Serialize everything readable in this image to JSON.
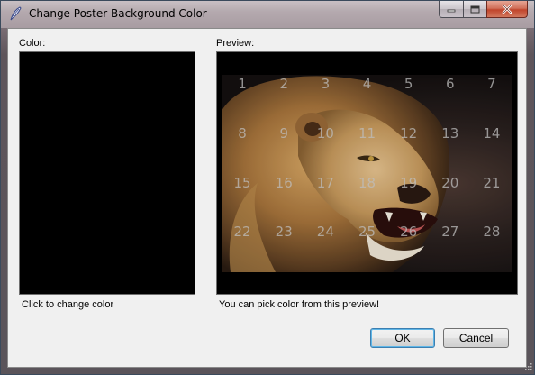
{
  "window": {
    "title": "Change Poster Background Color"
  },
  "color_panel": {
    "label": "Color:",
    "swatch_color": "#000000",
    "hint": "Click to change color"
  },
  "preview_panel": {
    "label": "Preview:",
    "hint": "You can pick color from this preview!",
    "grid_numbers": [
      "1",
      "2",
      "3",
      "4",
      "5",
      "6",
      "7",
      "8",
      "9",
      "10",
      "11",
      "12",
      "13",
      "14",
      "15",
      "16",
      "17",
      "18",
      "19",
      "20",
      "21",
      "22",
      "23",
      "24",
      "25",
      "26",
      "27",
      "28"
    ]
  },
  "buttons": {
    "ok": "OK",
    "cancel": "Cancel"
  },
  "icons": {
    "app": "quill-pen-icon",
    "minimize": "minimize-icon",
    "maximize": "maximize-icon",
    "close": "close-icon",
    "grip": "resize-grip-icon"
  }
}
